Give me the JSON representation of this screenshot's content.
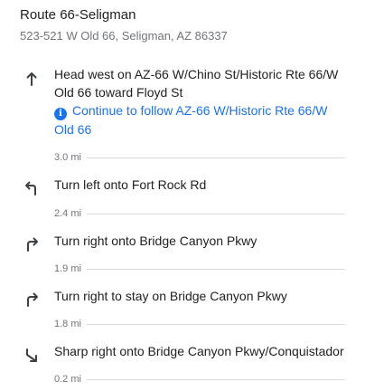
{
  "destination": {
    "title": "Route 66-Seligman",
    "address": "523-521 W Old 66, Seligman, AZ 86337"
  },
  "steps": [
    {
      "icon": "arrow-up-icon",
      "instruction": "Head west on AZ-66 W/Chino St/Historic Rte 66/W Old 66 toward Floyd St",
      "note": "Continue to follow AZ-66 W/Historic Rte 66/W Old 66",
      "note_icon": "info-icon",
      "distance": "3.0 mi"
    },
    {
      "icon": "turn-left-icon",
      "instruction": "Turn left onto Fort Rock Rd",
      "distance": "2.4 mi"
    },
    {
      "icon": "turn-right-icon",
      "instruction": "Turn right onto Bridge Canyon Pkwy",
      "distance": "1.9 mi"
    },
    {
      "icon": "turn-right-icon",
      "instruction": "Turn right to stay on Bridge Canyon Pkwy",
      "distance": "1.8 mi"
    },
    {
      "icon": "sharp-right-icon",
      "instruction": "Sharp right onto Bridge Canyon Pkwy/Conquistador",
      "distance": "0.2 mi"
    }
  ],
  "colors": {
    "text": "#202124",
    "secondary": "#70757a",
    "link": "#1a73e8",
    "divider": "#dadce0",
    "icon": "#3c4043"
  }
}
